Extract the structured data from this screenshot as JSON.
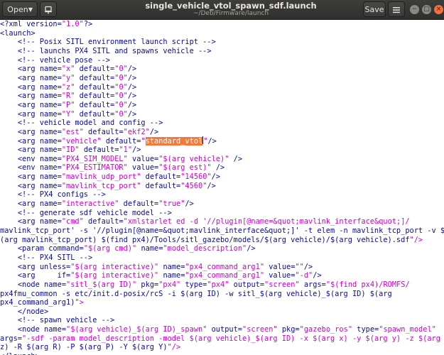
{
  "header": {
    "open_label": "Open",
    "title": "single_vehicle_vtol_spawn_sdf.launch",
    "subtitle": "~/Deb/Firmware/launch",
    "save_label": "Save",
    "icons": {
      "open_menu": "chevron-down-icon",
      "pin": "pin-icon",
      "hamburger": "hamburger-menu-icon",
      "minimize": "minimize-icon",
      "maximize": "maximize-icon",
      "close": "close-icon"
    }
  },
  "colors": {
    "tag": "#0a0aa8",
    "value": "#d000d0",
    "highlight": "#f37a3a"
  },
  "editor": {
    "lines": [
      "<?xml version=\"1.0\"?>",
      "<launch>",
      "    <!-- Posix SITL environment launch script -->",
      "    <!-- launchs PX4 SITL and spawns vehicle -->",
      "    <!-- vehicle pose -->",
      "    <arg name=\"x\" default=\"0\"/>",
      "    <arg name=\"y\" default=\"0\"/>",
      "    <arg name=\"z\" default=\"0\"/>",
      "    <arg name=\"R\" default=\"0\"/>",
      "    <arg name=\"P\" default=\"0\"/>",
      "    <arg name=\"Y\" default=\"0\"/>",
      "    <!-- vehicle model and config -->",
      "    <arg name=\"est\" default=\"ekf2\"/>",
      "    <arg name=\"vehicle\" default=\"standard_vtol\"/>",
      "    <arg name=\"ID\" default=\"1\"/>",
      "    <env name=\"PX4_SIM_MODEL\" value=\"$(arg vehicle)\" />",
      "    <env name=\"PX4_ESTIMATOR\" value=\"$(arg est)\" />",
      "    <arg name=\"mavlink_udp_port\" default=\"14560\"/>",
      "    <arg name=\"mavlink_tcp_port\" default=\"4560\"/>",
      "    <!-- PX4 configs -->",
      "    <arg name=\"interactive\" default=\"true\"/>",
      "    <!-- generate sdf vehicle model -->",
      "    <arg name=\"cmd\" default=\"xmlstarlet ed -d '//plugin[@name=&quot;mavlink_interface&quot;]/",
      "mavlink_tcp_port' -s '//plugin[@name=&quot;mavlink_interface&quot;]' -t elem -n mavlink_tcp_port -v $",
      "(arg mavlink_tcp_port) $(find px4)/Tools/sitl_gazebo/models/$(arg vehicle)/$(arg vehicle).sdf\"/>",
      "    <param command=\"$(arg cmd)\" name=\"model_description\"/>",
      "    <!-- PX4 SITL -->",
      "    <arg unless=\"$(arg interactive)\" name=\"px4_command_arg1\" value=\"\"/>",
      "    <arg     if=\"$(arg interactive)\" name=\"px4_command_arg1\" value=\"-d\"/>",
      "    <node name=\"sitl_$(arg ID)\" pkg=\"px4\" type=\"px4\" output=\"screen\" args=\"$(find px4)/ROMFS/",
      "px4fmu_common -s etc/init.d-posix/rcS -i $(arg ID) -w sitl_$(arg vehicle)_$(arg ID) $(arg",
      "px4_command_arg1)\">",
      "    </node>",
      "    <!-- spawn vehicle -->",
      "    <node name=\"$(arg vehicle)_$(arg ID)_spawn\" output=\"screen\" pkg=\"gazebo_ros\" type=\"spawn_model\"",
      "args=\"-sdf -param model_description -model $(arg vehicle)_$(arg ID) -x $(arg x) -y $(arg y) -z $(arg",
      "z) -R $(arg R) -P $(arg P) -Y $(arg Y)\"/>",
      "</launch>"
    ],
    "selected_text": "standard_vtol",
    "selected_line": 13
  }
}
